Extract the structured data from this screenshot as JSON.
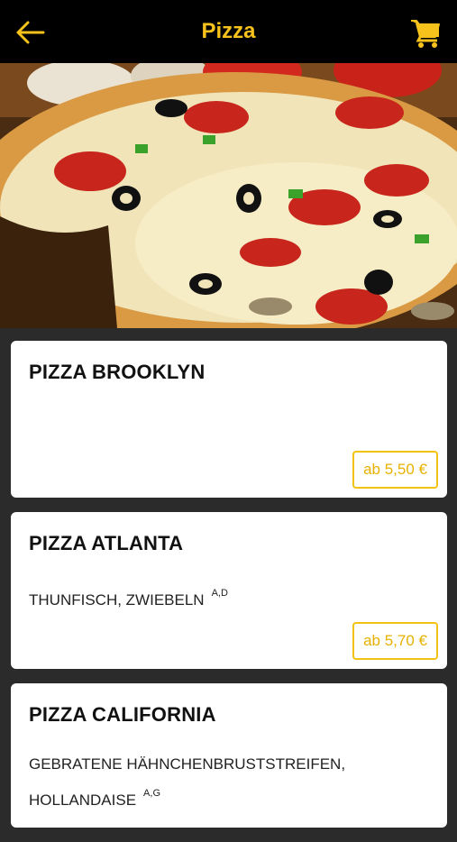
{
  "header": {
    "title": "Pizza",
    "back_icon": "arrow-left-icon",
    "cart_icon": "shopping-cart-icon",
    "accent_color": "#f6c21b"
  },
  "products": [
    {
      "name": "PIZZA BROOKLYN",
      "description": "",
      "allergens": "",
      "price": "ab 5,50 €"
    },
    {
      "name": "PIZZA ATLANTA",
      "description": "THUNFISCH, ZWIEBELN",
      "allergens": "A,D",
      "price": "ab 5,70 €"
    },
    {
      "name": "PIZZA CALIFORNIA",
      "description": "GEBRATENE HÄHNCHENBRUSTSTREIFEN, HOLLANDAISE",
      "allergens": "A,G",
      "price": ""
    }
  ]
}
